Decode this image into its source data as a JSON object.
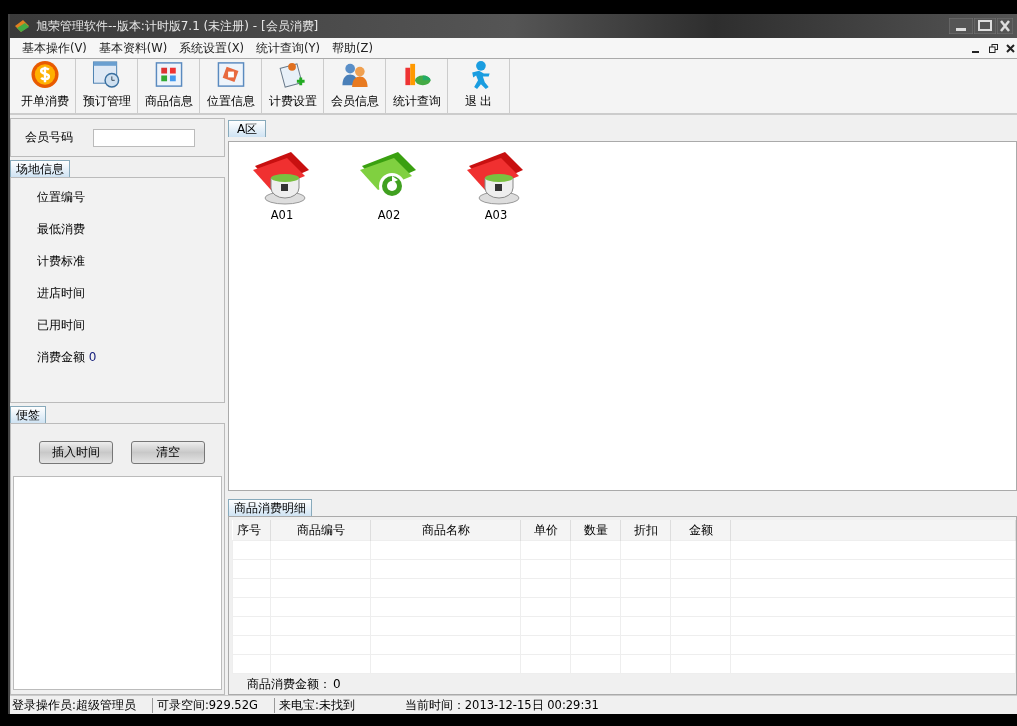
{
  "window": {
    "title": "旭荣管理软件--版本:计时版7.1 (未注册) - [会员消费]"
  },
  "menu": [
    "基本操作(V)",
    "基本资料(W)",
    "系统设置(X)",
    "统计查询(Y)",
    "帮助(Z)"
  ],
  "toolbar": [
    {
      "label": "开单消费",
      "kind": "coin"
    },
    {
      "label": "预订管理",
      "kind": "clock"
    },
    {
      "label": "商品信息",
      "kind": "grid"
    },
    {
      "label": "位置信息",
      "kind": "map"
    },
    {
      "label": "计费设置",
      "kind": "pen"
    },
    {
      "label": "会员信息",
      "kind": "users"
    },
    {
      "label": "统计查询",
      "kind": "chart"
    },
    {
      "label": "退 出",
      "kind": "exit"
    }
  ],
  "member": {
    "label": "会员号码"
  },
  "venue_info": {
    "tab": "场地信息",
    "fields": [
      {
        "label": "位置编号"
      },
      {
        "label": "最低消费"
      },
      {
        "label": "计费标准"
      },
      {
        "label": "进店时间"
      },
      {
        "label": "已用时间"
      },
      {
        "label": "消费金额",
        "value": "0"
      }
    ]
  },
  "notes": {
    "tab": "便签",
    "buttons": [
      "插入时间",
      "清空"
    ]
  },
  "zone": {
    "tab": "A区",
    "seats": [
      {
        "name": "A01",
        "occupied": true
      },
      {
        "name": "A02",
        "occupied": false
      },
      {
        "name": "A03",
        "occupied": true
      }
    ]
  },
  "details": {
    "tab": "商品消费明细",
    "columns": [
      "序号",
      "商品编号",
      "商品名称",
      "单价",
      "数量",
      "折扣",
      "金额"
    ],
    "total_label": "商品消费金额：",
    "total": "0"
  },
  "status_bar": [
    "登录操作员:超级管理员",
    "可录空间:929.52G",
    "来电宝:未找到",
    "当前时间：2013-12-15日 00:29:31"
  ]
}
